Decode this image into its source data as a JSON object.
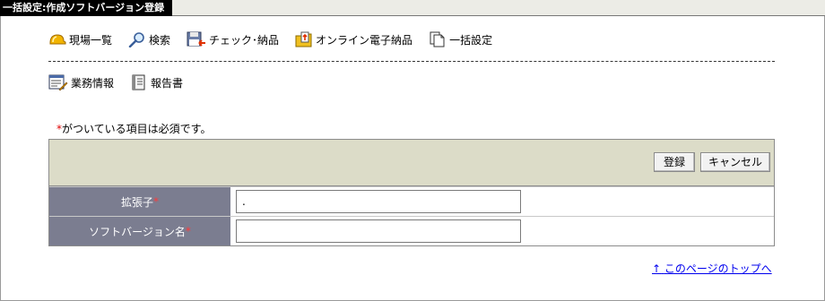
{
  "title": "一括設定:作成ソフトバージョン登録",
  "menu_primary": [
    {
      "label": "現場一覧",
      "icon": "helmet-icon"
    },
    {
      "label": "検索",
      "icon": "magnifier-icon"
    },
    {
      "label": "チェック･納品",
      "icon": "floppy-disk-icon"
    },
    {
      "label": "オンライン電子納品",
      "icon": "folder-upload-icon"
    },
    {
      "label": "一括設定",
      "icon": "documents-icon"
    }
  ],
  "menu_secondary": [
    {
      "label": "業務情報",
      "icon": "business-info-icon"
    },
    {
      "label": "報告書",
      "icon": "report-icon"
    }
  ],
  "required_note": {
    "mark": "*",
    "text": "がついている項目は必須です。"
  },
  "form": {
    "register_label": "登録",
    "cancel_label": "キャンセル",
    "fields": [
      {
        "label": "拡張子",
        "required_mark": "*",
        "value": "."
      },
      {
        "label": "ソフトバージョン名",
        "required_mark": "*",
        "value": ""
      }
    ]
  },
  "page_top_link": {
    "arrow": "↑",
    "label": "このページのトップへ"
  },
  "colors": {
    "label_bg": "#7b7d90",
    "header_bg": "#dcdcc8",
    "required": "#e00000",
    "link": "#0000ee"
  }
}
